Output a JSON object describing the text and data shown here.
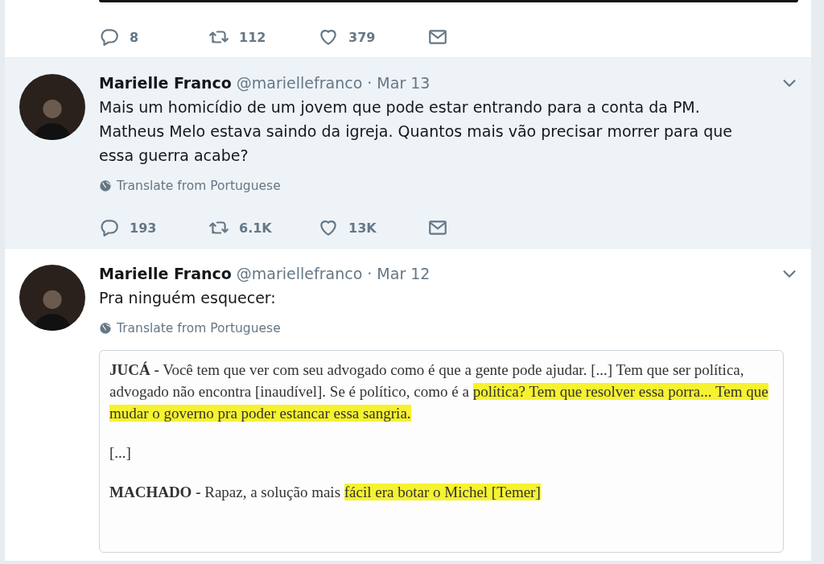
{
  "tweets": [
    {
      "kind": "media-tail",
      "hovered": false,
      "actions": {
        "replies": "8",
        "retweets": "112",
        "likes": "379"
      }
    },
    {
      "kind": "tweet",
      "hovered": true,
      "author": "Marielle Franco",
      "handle": "@mariellefranco",
      "date": "· Mar 13",
      "text": "Mais um homicídio de um jovem que pode estar entrando para a conta da PM. Matheus Melo estava saindo da igreja. Quantos mais vão precisar morrer para que essa guerra acabe?",
      "translate": "Translate from Portuguese",
      "actions": {
        "replies": "193",
        "retweets": "6.1K",
        "likes": "13K"
      }
    },
    {
      "kind": "tweet",
      "hovered": false,
      "author": "Marielle Franco",
      "handle": "@mariellefranco",
      "date": "· Mar 12",
      "text": "Pra ninguém esquecer:",
      "translate": "Translate from Portuguese",
      "document": [
        {
          "segments": [
            {
              "text": "JUCÁ -",
              "bold": true,
              "highlight": false
            },
            {
              "text": " Você tem que ver com seu advogado como é que a gente pode ajudar. [...] Tem que ser política, advogado não encontra [inaudível]. Se é político, como é a ",
              "bold": false,
              "highlight": false
            },
            {
              "text": "política? Tem que resolver essa porra... Tem que mudar o governo pra poder estancar essa sangria.",
              "bold": false,
              "highlight": true
            }
          ]
        },
        {
          "segments": [
            {
              "text": "[...]",
              "bold": false,
              "highlight": false
            }
          ]
        },
        {
          "segments": [
            {
              "text": "MACHADO -",
              "bold": true,
              "highlight": false
            },
            {
              "text": " Rapaz, a solução mais ",
              "bold": false,
              "highlight": false
            },
            {
              "text": "fácil era botar o Michel [Temer]",
              "bold": false,
              "highlight": true
            }
          ]
        }
      ]
    }
  ]
}
